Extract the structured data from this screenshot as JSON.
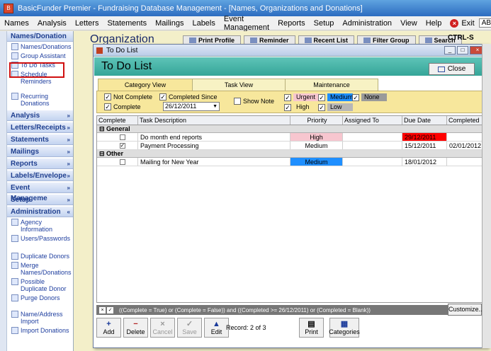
{
  "app": {
    "title": "BasicFunder Premier - Fundraising Database Management - [Names, Organizations and Donations]",
    "icon": "app-icon"
  },
  "menu": {
    "items": [
      "Names",
      "Analysis",
      "Letters",
      "Statements",
      "Mailings",
      "Labels",
      "Event Management",
      "Reports",
      "Setup",
      "Administration",
      "View",
      "Help"
    ],
    "exit_label": "Exit",
    "abc": "ABC"
  },
  "sidebar": {
    "names_header": "Names/Donation",
    "names_items": [
      "Names/Donations",
      "Group Assistant",
      "To Do Tasks",
      "Schedule Reminders",
      "Recurring Donations"
    ],
    "sections": [
      "Analysis",
      "Letters/Receipts",
      "Statements",
      "Mailings",
      "Reports",
      "Labels/Envelope",
      "Event Manageme",
      "Setup"
    ],
    "admin_header": "Administration",
    "admin_items": [
      "Agency Information",
      "Users/Passwords",
      "Duplicate Donors",
      "Merge Names/Donations",
      "Possible Duplicate Donor",
      "Purge Donors",
      "Name/Address Import",
      "Import Donations"
    ]
  },
  "org": {
    "header": "Organization",
    "buttons": [
      "Print Profile",
      "Reminder",
      "Recent List",
      "Filter Group",
      "Search"
    ],
    "shortcut": "CTRL-S"
  },
  "todo": {
    "window_title": "To Do List",
    "heading": "To Do List",
    "close_label": "Close",
    "tabs": [
      "Category View",
      "Task View",
      "Maintenance"
    ],
    "filters": {
      "not_complete": "Not Complete",
      "complete": "Complete",
      "completed_since": "Completed Since",
      "date": "26/12/2011",
      "show_note": "Show Note",
      "priorities": [
        "Urgent",
        "Medium",
        "None",
        "High",
        "Low"
      ]
    },
    "columns": [
      "Complete",
      "Task Description",
      "Priority",
      "Assigned To",
      "Due Date",
      "Completed"
    ],
    "groups": [
      {
        "name": "General",
        "rows": [
          {
            "complete": false,
            "task": "Do month end reports",
            "priority": "High",
            "assigned": "",
            "due": "29/12/2011",
            "completed": ""
          },
          {
            "complete": true,
            "task": "Payment Processing",
            "priority": "Medium",
            "assigned": "",
            "due": "15/12/2011",
            "completed": "02/01/2012"
          }
        ]
      },
      {
        "name": "Other",
        "rows": [
          {
            "complete": false,
            "task": "Mailing for New Year",
            "priority": "Medium",
            "assigned": "",
            "due": "18/01/2012",
            "completed": ""
          }
        ]
      }
    ],
    "filter_text": "((Complete = True) or (Complete = False)) and ((Completed >= 26/12/2011) or (Completed = Blank))",
    "customize_label": "Customize...",
    "toolbar": [
      "Add",
      "Delete",
      "Cancel",
      "Save",
      "Edit"
    ],
    "record_info": "Record: 2 of 3",
    "print_label": "Print",
    "categories_label": "Categories"
  },
  "colors": {
    "accent": "#35a598",
    "urgent": "#ff0000",
    "high": "#f7c6cf",
    "medium": "#1f8fff"
  }
}
